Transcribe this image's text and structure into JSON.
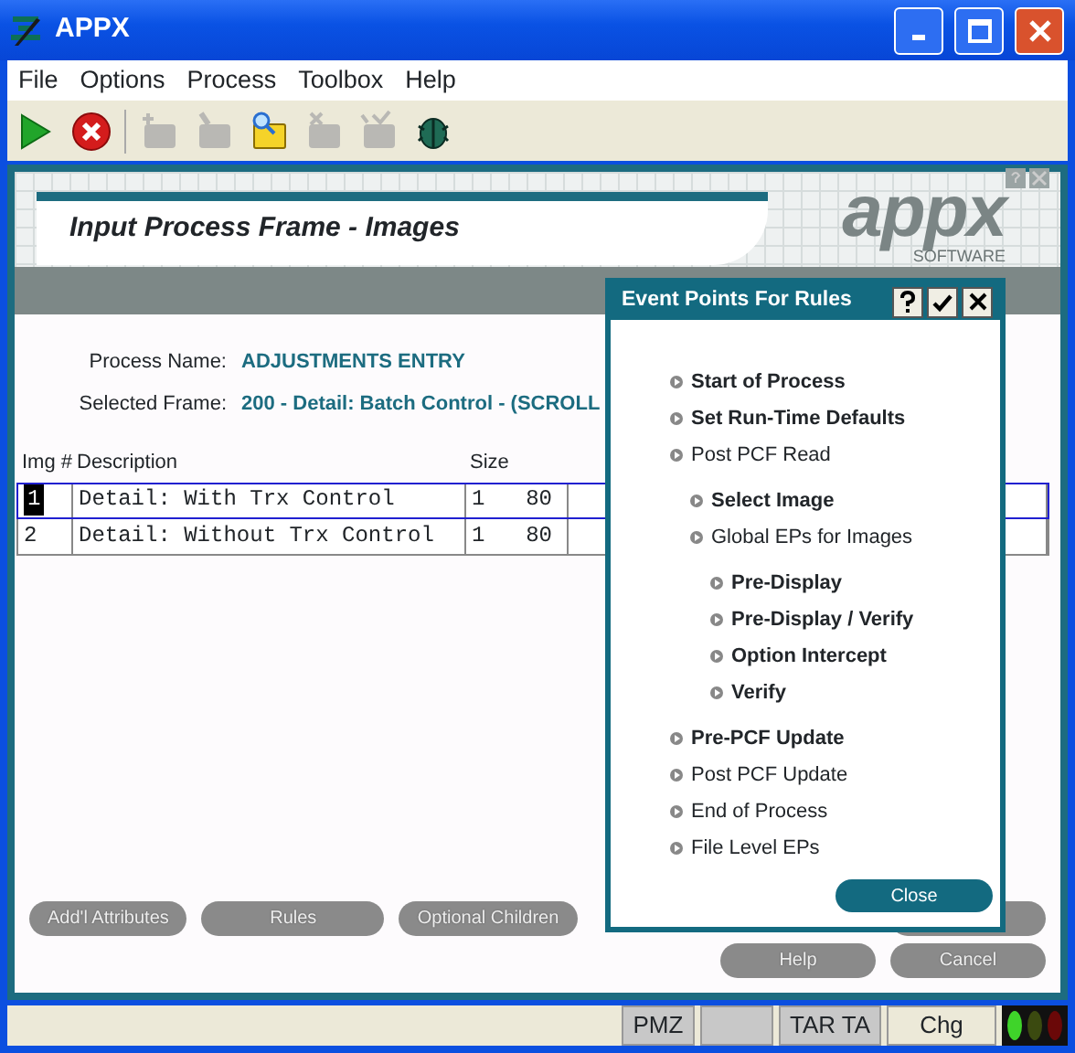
{
  "window": {
    "title": "APPX"
  },
  "menu": [
    "File",
    "Options",
    "Process",
    "Toolbox",
    "Help"
  ],
  "toolbar": [
    {
      "kind": "run",
      "disabled": false
    },
    {
      "kind": "stop",
      "disabled": false
    },
    {
      "kind": "folder-star",
      "disabled": true
    },
    {
      "kind": "folder-pen",
      "disabled": true
    },
    {
      "kind": "folder-search",
      "disabled": false
    },
    {
      "kind": "folder-x",
      "disabled": true
    },
    {
      "kind": "folder-check",
      "disabled": true
    },
    {
      "kind": "bug",
      "disabled": false
    }
  ],
  "header": {
    "title": "Input Process Frame - Images",
    "logo": "appx",
    "logo_sub": "SOFTWARE"
  },
  "fields": [
    {
      "label": "Process Name:",
      "value": "ADJUSTMENTS ENTRY"
    },
    {
      "label": "Selected Frame:",
      "value": "200 - Detail: Batch Control - (SCROLL"
    }
  ],
  "table": {
    "columns": [
      "Img #",
      "Description",
      "Size"
    ],
    "rows": [
      {
        "img": "1",
        "description": "Detail: With Trx Control",
        "size_from": "1",
        "size_to": "80",
        "selected": true
      },
      {
        "img": "2",
        "description": "Detail: Without Trx Control",
        "size_from": "1",
        "size_to": "80",
        "selected": false
      }
    ]
  },
  "buttons_left": [
    "Add'l Attributes",
    "Rules",
    "Optional Children"
  ],
  "buttons_right": [
    "Help",
    "Cancel"
  ],
  "dialog": {
    "title": "Event Points For Rules",
    "close": "Close",
    "items": [
      {
        "label": "Start of Process",
        "bold": true
      },
      {
        "label": "Set Run-Time Defaults",
        "bold": true
      },
      {
        "label": "Post PCF Read",
        "bold": false,
        "children": [
          {
            "label": "Select Image",
            "bold": true
          },
          {
            "label": "Global EPs for Images",
            "bold": false,
            "children": [
              {
                "label": "Pre-Display",
                "bold": true
              },
              {
                "label": "Pre-Display / Verify",
                "bold": true
              },
              {
                "label": "Option Intercept",
                "bold": true
              },
              {
                "label": "Verify",
                "bold": true
              }
            ]
          }
        ]
      },
      {
        "label": "Pre-PCF Update",
        "bold": true
      },
      {
        "label": "Post PCF Update",
        "bold": false
      },
      {
        "label": "End of Process",
        "bold": false
      },
      {
        "label": "File Level EPs",
        "bold": false
      }
    ]
  },
  "status_bar": [
    {
      "kind": "text",
      "text": "PMZ"
    },
    {
      "kind": "blank"
    },
    {
      "kind": "text",
      "text": "TAR TA"
    },
    {
      "kind": "text",
      "text": "Chg"
    }
  ]
}
